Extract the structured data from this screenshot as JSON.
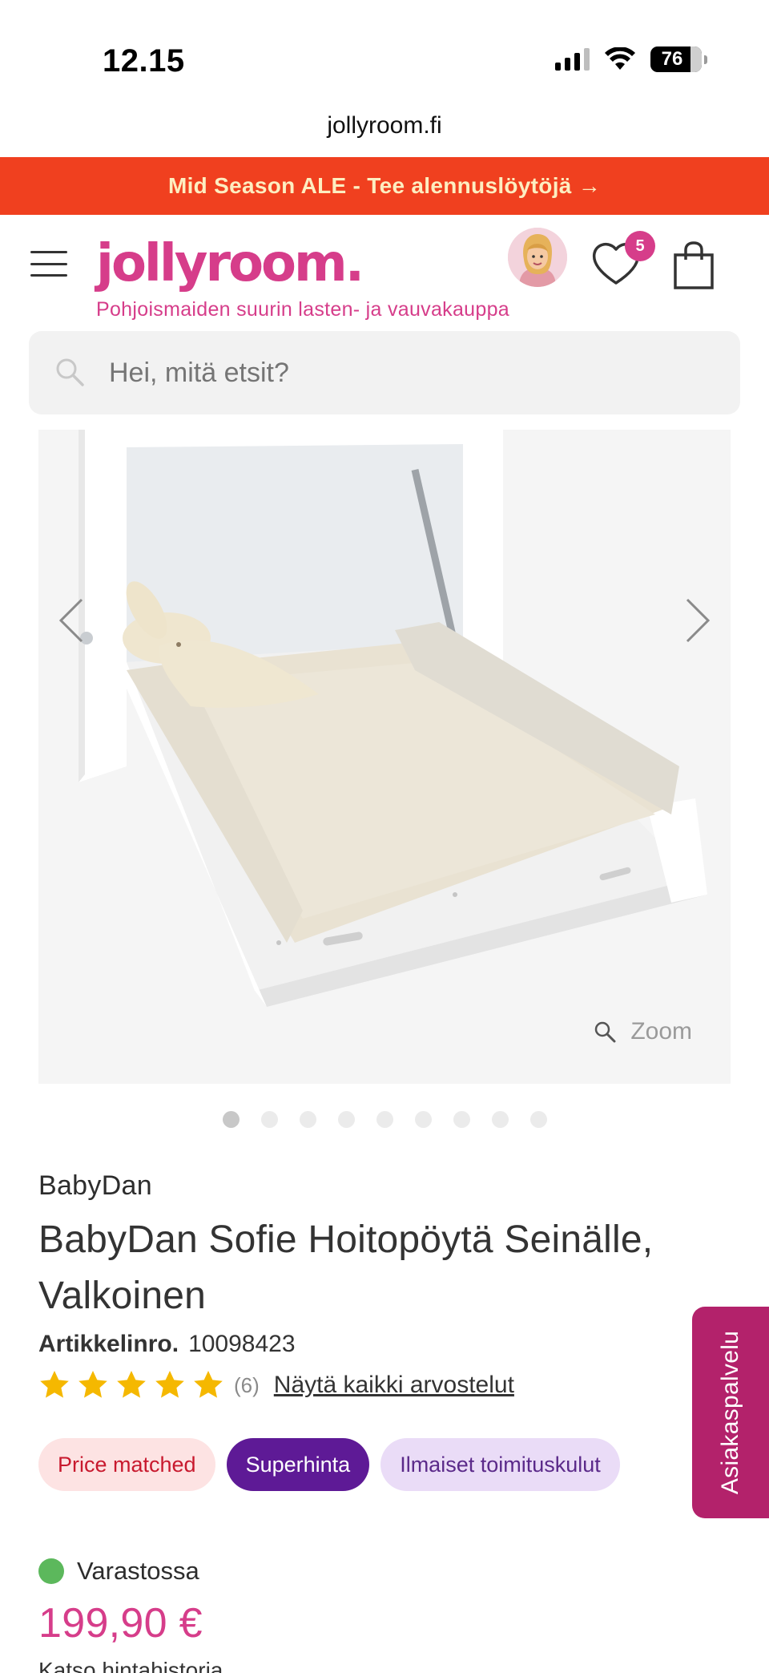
{
  "status_bar": {
    "time": "12.15",
    "battery": "76"
  },
  "browser": {
    "url": "jollyroom.fi"
  },
  "promo": {
    "text": "Mid Season ALE - Tee alennuslöytöjä →"
  },
  "header": {
    "logo": "jollyroom.",
    "tagline": "Pohjoismaiden suurin lasten- ja vauvakauppa",
    "wishlist_count": "5"
  },
  "search": {
    "placeholder": "Hei, mitä etsit?"
  },
  "gallery": {
    "zoom_label": "Zoom",
    "image_count": 9,
    "active_index": 0
  },
  "product": {
    "brand": "BabyDan",
    "title": "BabyDan Sofie Hoitopöytä Seinälle, Valkoinen",
    "sku_label": "Artikkelinro.",
    "sku": "10098423",
    "rating": 5,
    "review_count": "(6)",
    "reviews_link": "Näytä kaikki arvostelut",
    "badges": [
      "Price matched",
      "Superhinta",
      "Ilmaiset toimituskulut"
    ],
    "stock_status": "Varastossa",
    "price": "199,90 €",
    "price_history_link": "Katso hintahistoria"
  },
  "side_tab": {
    "label": "Asiakaspalvelu"
  },
  "colors": {
    "brand": "#d63d8a",
    "promo": "#f0401f",
    "superhinta": "#5e1a96",
    "star": "#f5b800",
    "in_stock": "#5cb85c"
  },
  "icons": [
    "hamburger-icon",
    "avatar",
    "heart-icon",
    "bag-icon",
    "search-icon",
    "chevron-left-icon",
    "chevron-right-icon",
    "zoom-icon",
    "star-icon"
  ]
}
